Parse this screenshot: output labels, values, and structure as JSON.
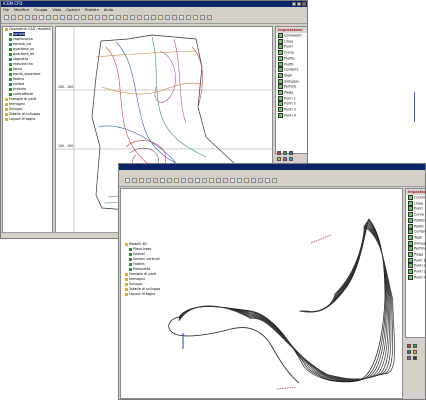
{
  "window1": {
    "title": "ICEM CFD",
    "menu": [
      "File",
      "Modifica",
      "Gruppo",
      "Vista",
      "Opzioni",
      "Finestre",
      "Aiuto"
    ],
    "tree": [
      {
        "label": "Geometrie CAD (modelli)",
        "type": "folder"
      },
      {
        "label": "tomaia",
        "type": "item",
        "selected": true
      },
      {
        "label": "copriscarpa",
        "type": "item"
      },
      {
        "label": "tomaia_int",
        "type": "item"
      },
      {
        "label": "quartiere_sx",
        "type": "item"
      },
      {
        "label": "quartiere_dx",
        "type": "item"
      },
      {
        "label": "linguetta",
        "type": "item"
      },
      {
        "label": "mascherina",
        "type": "item"
      },
      {
        "label": "tacco",
        "type": "item"
      },
      {
        "label": "bordo_superiore",
        "type": "item"
      },
      {
        "label": "fodera",
        "type": "item"
      },
      {
        "label": "collare",
        "type": "item"
      },
      {
        "label": "rinforzo",
        "type": "item"
      },
      {
        "label": "contrafforte",
        "type": "item"
      },
      {
        "label": "Famiglie di parti",
        "type": "folder"
      },
      {
        "label": "Immagini",
        "type": "folder"
      },
      {
        "label": "Sviluppi",
        "type": "folder"
      },
      {
        "label": "Tabelle di sviluppo",
        "type": "folder"
      },
      {
        "label": "Layout di taglio",
        "type": "folder"
      }
    ],
    "right_panel": {
      "header": "Impostazioni",
      "items": [
        "Commenti",
        "Linee",
        "Punti",
        "Curve",
        "Profilo",
        "Profili",
        "Contorni",
        "Tagli",
        "Sviluppo",
        "Perforo",
        "Piega",
        "Punti 1",
        "Punti 2",
        "Punti 3",
        "Punti 4"
      ]
    },
    "axis_labels": [
      "100 - 100",
      "100 - 100"
    ],
    "colors": {
      "accent": "#0a246a",
      "panel_header": "#b01818"
    }
  },
  "window2": {
    "tree": [
      {
        "label": "Modelli 3D",
        "type": "folder"
      },
      {
        "label": "Piano base",
        "type": "item"
      },
      {
        "label": "Sezioni",
        "type": "item"
      },
      {
        "label": "Sezioni verticali",
        "type": "item"
      },
      {
        "label": "Fodera",
        "type": "item"
      },
      {
        "label": "Profondita",
        "type": "item"
      },
      {
        "label": "Famiglie di parti",
        "type": "folder"
      },
      {
        "label": "Immagini",
        "type": "folder"
      },
      {
        "label": "Sviluppi",
        "type": "folder"
      },
      {
        "label": "Tabelle di sviluppo",
        "type": "folder"
      },
      {
        "label": "Layout di taglio",
        "type": "folder"
      }
    ],
    "right_panel": {
      "header": "Impostazioni",
      "items": [
        "Commenti",
        "Linee",
        "Punti",
        "Curve",
        "Profilo",
        "Profili",
        "Contorni",
        "Tagli",
        "Sviluppo",
        "Perforo",
        "Piega",
        "Punti 1",
        "Punti 2",
        "Punti 3",
        "Punti 4"
      ]
    }
  }
}
